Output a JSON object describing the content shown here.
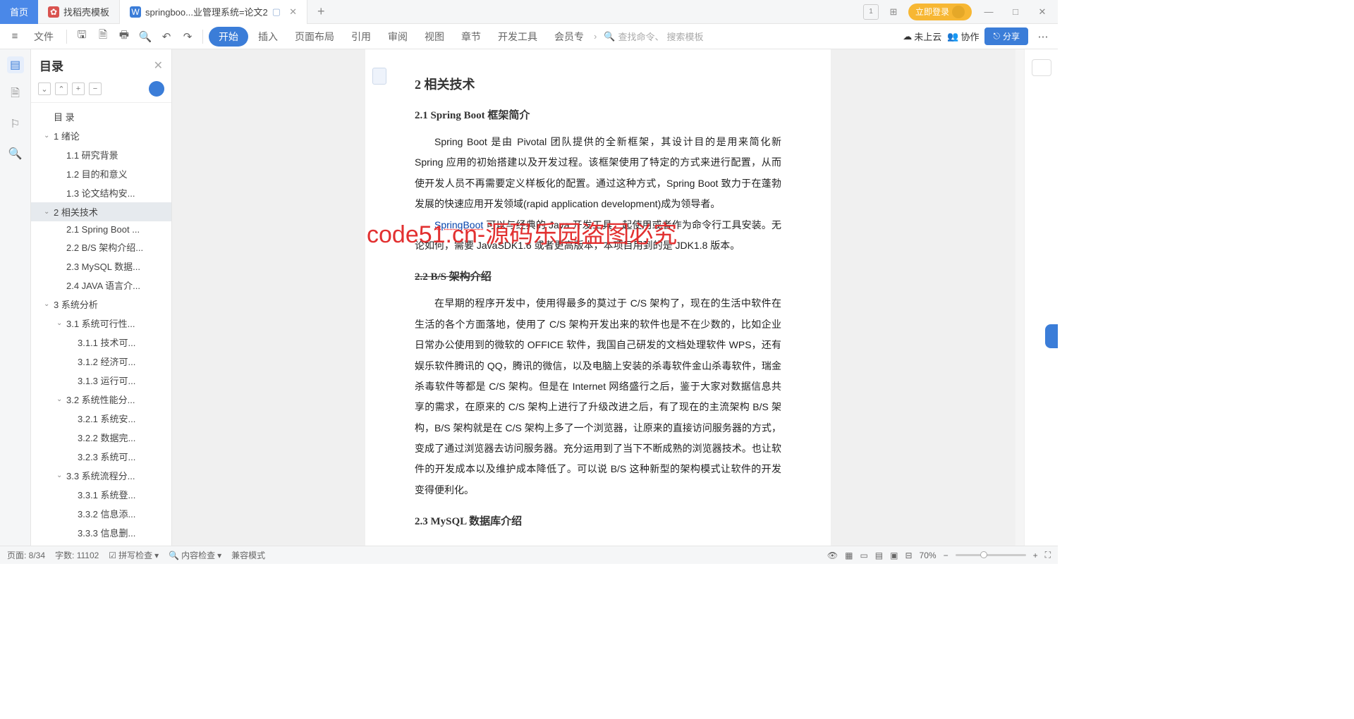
{
  "titlebar": {
    "home": "首页",
    "tab1": "找稻壳模板",
    "tab2": "springboo...业管理系统=论文2",
    "login": "立即登录"
  },
  "toolbar": {
    "file": "文件",
    "start": "开始",
    "insert": "插入",
    "layout": "页面布局",
    "reference": "引用",
    "review": "审阅",
    "view": "视图",
    "chapter": "章节",
    "devtools": "开发工具",
    "member": "会员专",
    "search_cmd": "查找命令、",
    "search_tpl": "搜索模板",
    "cloud": "未上云",
    "collab": "协作",
    "share": "分享"
  },
  "outline": {
    "title": "目录",
    "items": [
      {
        "lvl": "l1",
        "chev": "",
        "label": "目 录"
      },
      {
        "lvl": "l1",
        "chev": "⌄",
        "label": "1 绪论"
      },
      {
        "lvl": "l2",
        "chev": "",
        "label": "1.1 研究背景"
      },
      {
        "lvl": "l2",
        "chev": "",
        "label": "1.2 目的和意义"
      },
      {
        "lvl": "l2",
        "chev": "",
        "label": "1.3 论文结构安..."
      },
      {
        "lvl": "l1",
        "chev": "⌄",
        "label": "2 相关技术",
        "selected": true
      },
      {
        "lvl": "l2",
        "chev": "",
        "label": "2.1 Spring Boot ..."
      },
      {
        "lvl": "l2",
        "chev": "",
        "label": "2.2 B/S 架构介绍..."
      },
      {
        "lvl": "l2",
        "chev": "",
        "label": "2.3 MySQL 数据..."
      },
      {
        "lvl": "l2",
        "chev": "",
        "label": "2.4 JAVA 语言介..."
      },
      {
        "lvl": "l1",
        "chev": "⌄",
        "label": "3 系统分析"
      },
      {
        "lvl": "l2",
        "chev": "⌄",
        "label": "3.1 系统可行性..."
      },
      {
        "lvl": "l3",
        "chev": "",
        "label": "3.1.1 技术可..."
      },
      {
        "lvl": "l3",
        "chev": "",
        "label": "3.1.2 经济可..."
      },
      {
        "lvl": "l3",
        "chev": "",
        "label": "3.1.3 运行可..."
      },
      {
        "lvl": "l2",
        "chev": "⌄",
        "label": "3.2 系统性能分..."
      },
      {
        "lvl": "l3",
        "chev": "",
        "label": "3.2.1 系统安..."
      },
      {
        "lvl": "l3",
        "chev": "",
        "label": "3.2.2 数据完..."
      },
      {
        "lvl": "l3",
        "chev": "",
        "label": "3.2.3 系统可..."
      },
      {
        "lvl": "l2",
        "chev": "⌄",
        "label": "3.3 系统流程分..."
      },
      {
        "lvl": "l3",
        "chev": "",
        "label": "3.3.1 系统登..."
      },
      {
        "lvl": "l3",
        "chev": "",
        "label": "3.3.2 信息添..."
      },
      {
        "lvl": "l3",
        "chev": "",
        "label": "3.3.3 信息删..."
      }
    ]
  },
  "document": {
    "h2": "2  相关技术",
    "s21_title": "2.1 Spring Boot 框架简介",
    "s21_p1": "Spring Boot 是由 Pivotal 团队提供的全新框架，其设计目的是用来简化新 Spring 应用的初始搭建以及开发过程。该框架使用了特定的方式来进行配置，从而使开发人员不再需要定义样板化的配置。通过这种方式，Spring Boot 致力于在蓬勃发展的快速应用开发领域(rapid application development)成为领导者。",
    "s21_link": "SpringBoot",
    "s21_p2": " 可以与经典的 Java 开发工具一起使用或者作为命令行工具安装。无论如何，需要 JavaSDK1.6 或者更高版本，本项目用到的是 JDK1.8 版本。",
    "s22_title": "2.2 B/S 架构介绍",
    "s22_p": "在早期的程序开发中，使用得最多的莫过于 C/S 架构了，现在的生活中软件在生活的各个方面落地，使用了 C/S 架构开发出来的软件也是不在少数的，比如企业日常办公使用到的微软的 OFFICE 软件，我国自己研发的文档处理软件 WPS，还有娱乐软件腾讯的 QQ，腾讯的微信，以及电脑上安装的杀毒软件金山杀毒软件，瑞金杀毒软件等都是 C/S 架构。但是在 Internet 网络盛行之后，鉴于大家对数据信息共享的需求，在原来的 C/S 架构上进行了升级改进之后，有了现在的主流架构 B/S 架构，B/S 架构就是在 C/S 架构上多了一个浏览器，让原来的直接访问服务器的方式，变成了通过浏览器去访问服务器。充分运用到了当下不断成熟的浏览器技术。也让软件的开发成本以及维护成本降低了。可以说 B/S 这种新型的架构模式让软件的开发变得便利化。",
    "s23_title": "2.3 MySQL 数据库介绍"
  },
  "watermark_big": "code51.cn-源码乐园盗图必究",
  "watermark_text": "code51.cn",
  "statusbar": {
    "page": "页面: 8/34",
    "words": "字数: 11102",
    "spell": "拼写检查",
    "content": "内容检查",
    "compat": "兼容模式",
    "zoom": "70%"
  }
}
